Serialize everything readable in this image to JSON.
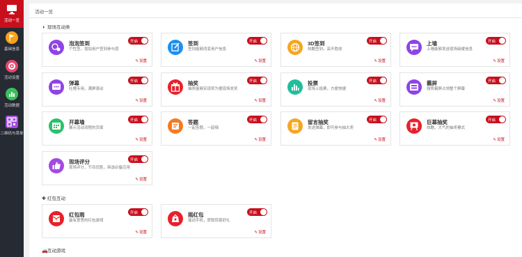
{
  "sidebar": {
    "items": [
      {
        "label": "活动一览",
        "icon": "monitor-icon",
        "color": "#ffffff"
      },
      {
        "label": "基础信息",
        "icon": "flag-icon",
        "color": "#f7a21b"
      },
      {
        "label": "活动设置",
        "icon": "gear-icon",
        "color": "#e8456d"
      },
      {
        "label": "活动数据",
        "icon": "chart-icon",
        "color": "#3bbf5c"
      },
      {
        "label": "二维码与菜单",
        "icon": "qrcode-icon",
        "color": "#a24be0"
      }
    ]
  },
  "tab": {
    "label": "活动一览"
  },
  "common": {
    "toggle": "开启",
    "setting": "设置"
  },
  "sections": {
    "s1": {
      "icon": "◑",
      "title": "现场互动类"
    },
    "s2": {
      "icon": "✚",
      "title": "红包互动"
    },
    "s3": {
      "icon": "🚗",
      "title": "互动游戏"
    }
  },
  "cards": {
    "c1": {
      "title": "泡泡签到",
      "desc": "个性签，增加用户签到参与感",
      "icon": "bubble-signin-icon",
      "color": "#8e44e6"
    },
    "c2": {
      "title": "签到",
      "desc": "签到能够改变用户信息",
      "icon": "pen-icon",
      "color": "#1e8ff0"
    },
    "c3": {
      "title": "3D签到",
      "desc": "炫酷签到，高不胜收",
      "icon": "globe-icon",
      "color": "#f5a623"
    },
    "c4": {
      "title": "上墙",
      "desc": "上墙能够发送现场级缓信息",
      "icon": "message-icon",
      "color": "#8e44e6"
    },
    "c5": {
      "title": "弹幕",
      "desc": "吐槽专用，满屏滚动",
      "icon": "danmu-icon",
      "color": "#8e44e6"
    },
    "c6": {
      "title": "抽奖",
      "desc": "抽奖能够实现奖为便现场发奖",
      "icon": "gift-icon",
      "color": "#e8202b"
    },
    "c7": {
      "title": "投票",
      "desc": "现场上投票，方便快捷",
      "icon": "bar-chart-icon",
      "color": "#1fbf9c"
    },
    "c8": {
      "title": "霸屏",
      "desc": "强势霸屏占领整个屏幕",
      "icon": "screen-icon",
      "color": "#8e44e6"
    },
    "c9": {
      "title": "开幕墙",
      "desc": "展示活动流程的页面",
      "icon": "calendar-icon",
      "color": "#2bc06b"
    },
    "c10": {
      "title": "答题",
      "desc": "一起答题，一起嗨",
      "icon": "quiz-icon",
      "color": "#f47b20"
    },
    "c11": {
      "title": "留言抽奖",
      "desc": "发送弹幕，即可参与抽大奖",
      "icon": "note-icon",
      "color": "#f5a623"
    },
    "c12": {
      "title": "巨幕抽奖",
      "desc": "炫酷，大气的抽奖模式",
      "icon": "easel-icon",
      "color": "#e8202b"
    },
    "c13": {
      "title": "现场评分",
      "desc": "现场评分，节目优胜，商选必备应用",
      "icon": "thumbs-up-icon",
      "color": "#a24be0"
    },
    "c14": {
      "title": "红包雨",
      "desc": "最有意思的红包游戏",
      "icon": "red-envelope-icon",
      "color": "#e8202b"
    },
    "c15": {
      "title": "摇红包",
      "desc": "摇动手机，获取惊喜好礼",
      "icon": "shake-envelope-icon",
      "color": "#e8202b"
    }
  }
}
